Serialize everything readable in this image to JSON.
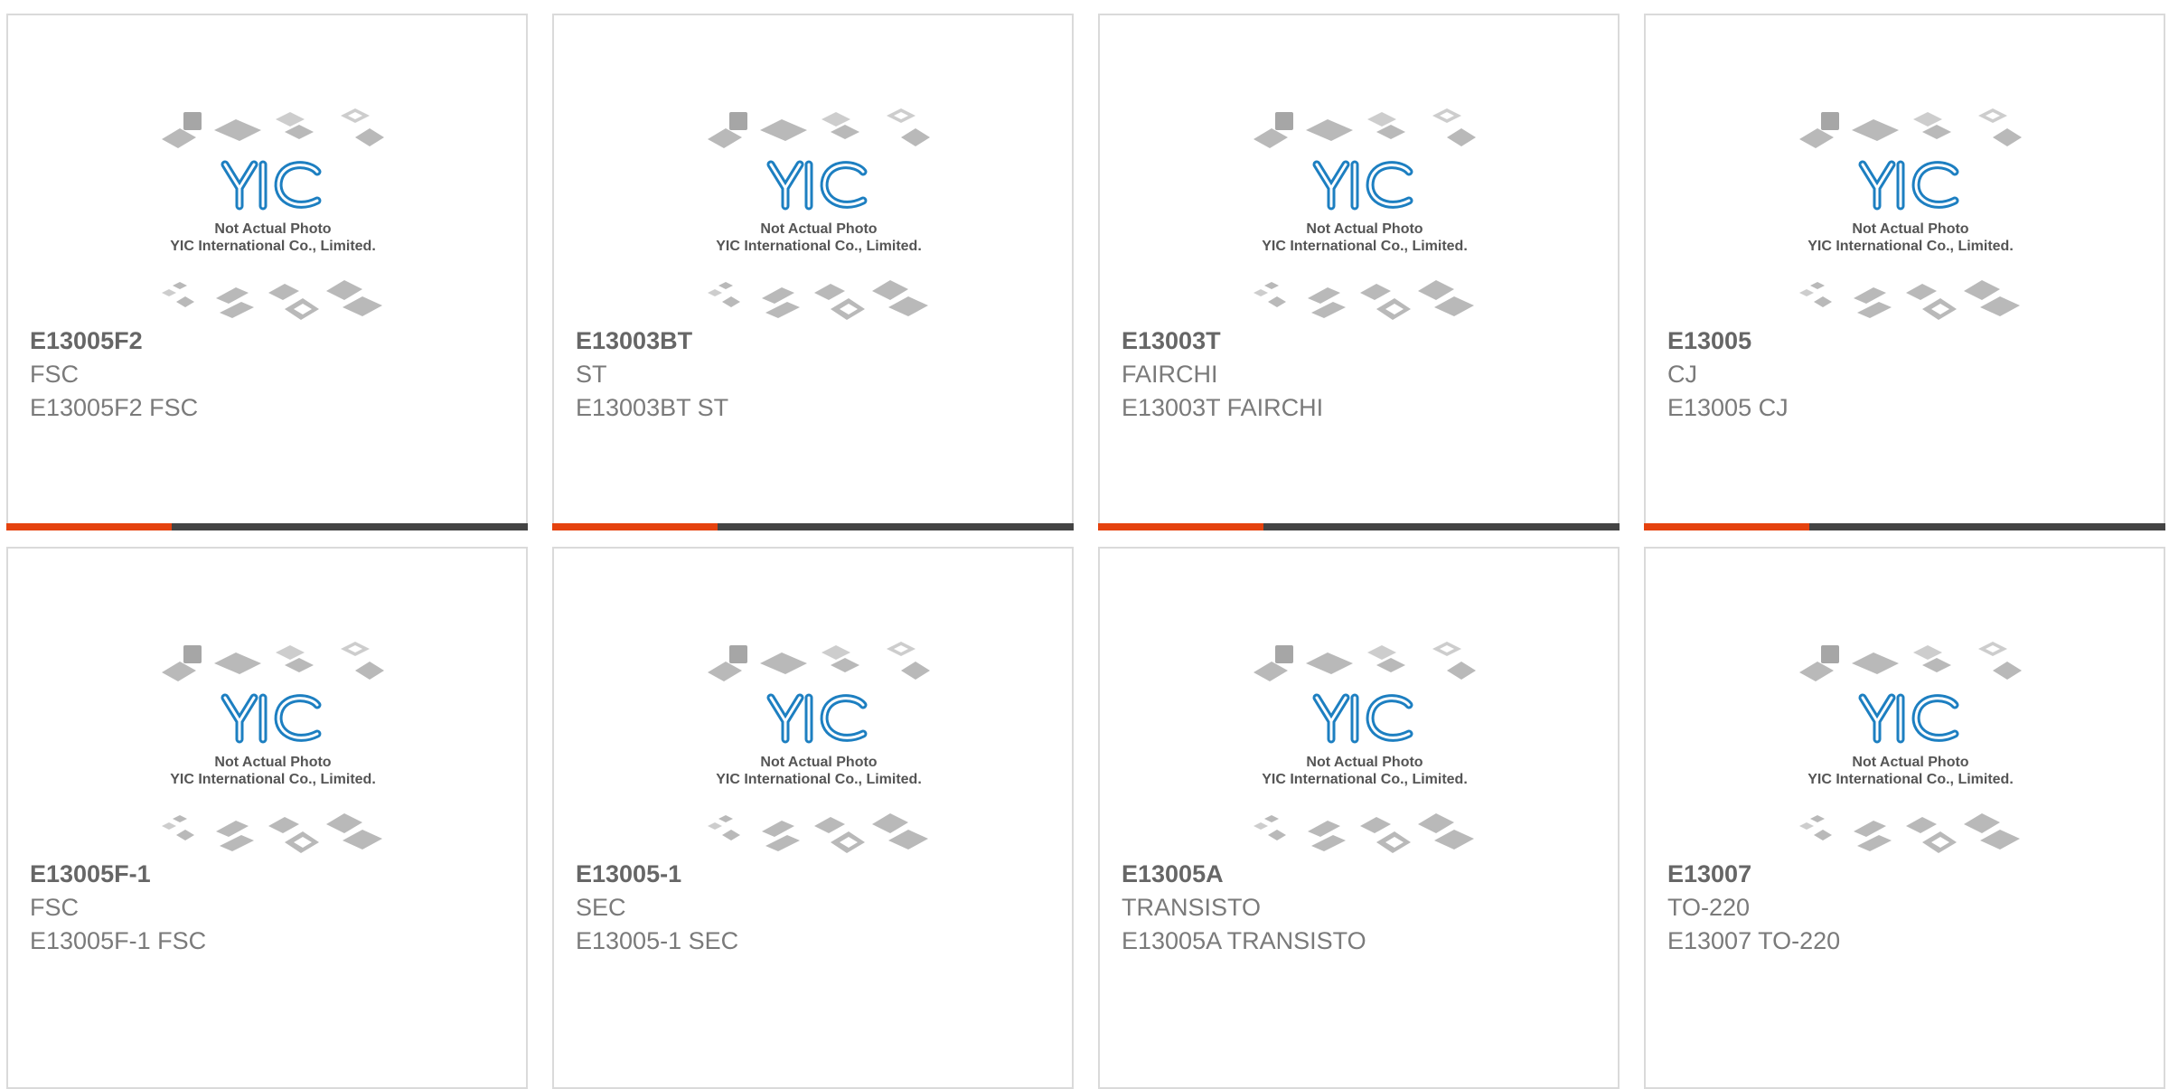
{
  "cards": [
    {
      "part": "E13005F2",
      "brand": "FSC",
      "desc": "E13005F2 FSC"
    },
    {
      "part": "E13003BT",
      "brand": "ST",
      "desc": "E13003BT ST"
    },
    {
      "part": "E13003T",
      "brand": "FAIRCHI",
      "desc": "E13003T FAIRCHI"
    },
    {
      "part": "E13005",
      "brand": "CJ",
      "desc": "E13005 CJ"
    },
    {
      "part": "E13005F-1",
      "brand": "FSC",
      "desc": "E13005F-1 FSC"
    },
    {
      "part": "E13005-1",
      "brand": "SEC",
      "desc": "E13005-1 SEC"
    },
    {
      "part": "E13005A",
      "brand": "TRANSISTO",
      "desc": "E13005A TRANSISTO"
    },
    {
      "part": "E13007",
      "brand": "TO-220",
      "desc": "E13007 TO-220"
    }
  ],
  "placeholder": {
    "logo_text": "YIC",
    "caption_line1": "Not Actual Photo",
    "caption_line2": "YIC International Co., Limited."
  },
  "colors": {
    "accent": "#e5420e",
    "bar": "#444444",
    "logo": "#1d7fc1",
    "border": "#dadada"
  },
  "icons": {
    "placeholder_image": "chip-packages-placeholder-icon"
  }
}
